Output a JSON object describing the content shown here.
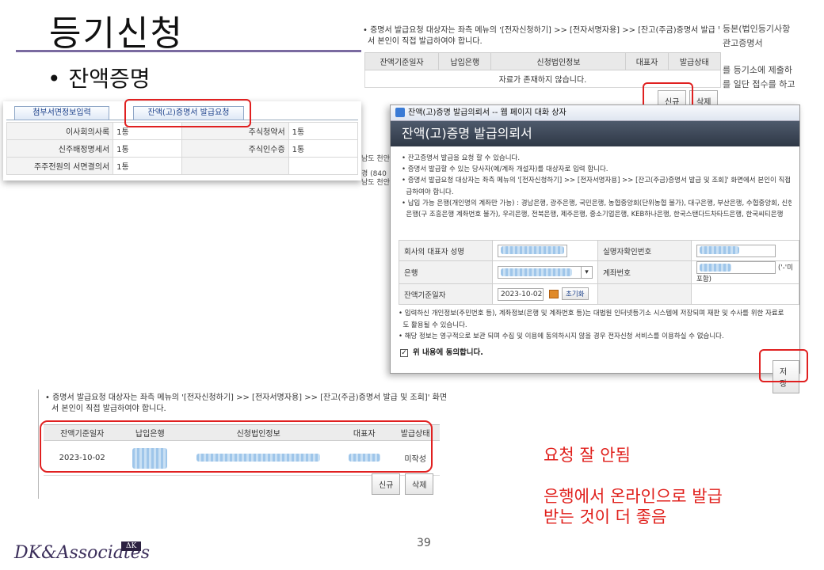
{
  "slide": {
    "title": "등기신청",
    "bullet": "잔액증명",
    "page_number": "39",
    "logo_text": "DK&Associates",
    "logo_badge": "ΔK"
  },
  "attachment_panel": {
    "tabs": [
      "첨부서면정보입력",
      "잔액(고)증명서 발급요청"
    ],
    "rows": [
      {
        "label": "이사회의사록",
        "value": "1통",
        "label2": "주식청약서",
        "value2": "1통"
      },
      {
        "label": "신주배정명세서",
        "value": "1통",
        "label2": "주식인수증",
        "value2": "1통"
      },
      {
        "label": "주주전원의 서면결의서",
        "value": "1통",
        "label2": "",
        "value2": ""
      }
    ],
    "side_text": [
      "남도 천안",
      "경 (840",
      "남도 천안"
    ]
  },
  "top_list": {
    "note_line1": "• 증명서 발급요청 대상자는 좌측 메뉴의 '[전자신청하기] >> [전자서명자용] >> [잔고(주금)증명서 발급 및 조회]' 화면에",
    "note_line2": "서 본인이 직접 발급하여야 합니다.",
    "columns": [
      "잔액기준일자",
      "납입은행",
      "신청법인정보",
      "대표자",
      "발급상태"
    ],
    "empty_message": "자료가 존재하지 않습니다.",
    "new_button": "신규",
    "delete_button": "삭제",
    "bg_right": [
      "등본(법인등기사항",
      "관고증명서",
      "를 등기소에 제출하",
      "를 일단 접수를 하고"
    ]
  },
  "dialog": {
    "window_title": "잔액(고)증명 발급의뢰서 -- 웹 페이지 대화 상자",
    "header": "잔액(고)증명 발급의뢰서",
    "notes": [
      "• 잔고증명서 발급을 요청 할 수 있습니다.",
      "• 증명서 발급할 수 있는 당사자(예/계좌 개설자)를 대상자로 입력 합니다.",
      "• 증명서 발급요청 대상자는 좌측 메뉴의 '[전자신청하기] >> [전자서명자용] >> [잔고(주금)증명서 발급 및 조회]' 화면에서 본인이 직접 발",
      "  급하여야 합니다.",
      "• 납입 가능 은행(개인명의 계좌만 가능) : 경남은행, 광주은행, 국민은행, 농협중앙회(단위농협 불가), 대구은행, 부산은행, 수협중앙회, 신한",
      "  은행(구 조흥은행 계좌번호 불가), 우리은행, 전북은행, 제주은행, 중소기업은행, KEB하나은행, 한국스탠다드차타드은행, 한국씨티은행"
    ],
    "form": {
      "rep_name_label": "회사의 대표자 성명",
      "real_name_label": "실명자확인번호",
      "bank_label": "은행",
      "account_label": "계좌번호",
      "account_hint": "('-'미포함)",
      "date_label": "잔액기준일자",
      "date_value": "2023-10-02",
      "reset_button": "초기화"
    },
    "notes2": [
      "• 입력하신 개인정보(주민번호 등), 계좌정보(은행 및 계좌번호 등)는 대법원 인터넷등기소 시스템에 저장되며 재판 및 수사를 위한 자료로",
      "  도 활용될 수 있습니다.",
      "• 해당 정보는 영구적으로 보관 되며 수집 및 이용에 동의하시지 않을 경우 전자신청 서비스를 이용하실 수 없습니다."
    ],
    "agree_text": "위 내용에 동의합니다.",
    "save_button": "저장"
  },
  "bottom_list": {
    "note_line1": "• 증명서 발급요청 대상자는 좌측 메뉴의 '[전자신청하기] >> [전자서명자용] >> [잔고(주금)증명서 발급 및 조회]' 화면에",
    "note_line2": "서 본인이 직접 발급하여야 합니다.",
    "columns": [
      "잔액기준일자",
      "납입은행",
      "신청법인정보",
      "대표자",
      "발급상태"
    ],
    "row": {
      "date": "2023-10-02",
      "status": "미작성"
    },
    "new_button": "신규",
    "delete_button": "삭제"
  },
  "annotation": {
    "line1": "요청 잘 안됨",
    "line2": "은행에서 온라인으로 발급",
    "line3": "받는 것이 더 좋음"
  },
  "colors": {
    "highlight": "#e02020",
    "annotation": "#e0201c",
    "title_rule": "#7a6aa0"
  }
}
